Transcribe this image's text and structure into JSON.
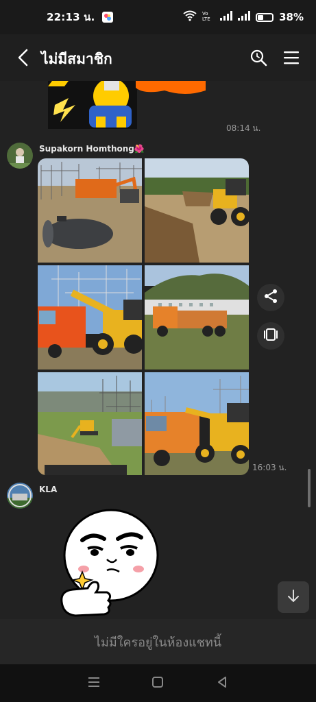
{
  "status_bar": {
    "time": "22:13 น.",
    "battery": "38%",
    "volte": "Vo LTE"
  },
  "header": {
    "title": "ไม่มีสมาชิก"
  },
  "messages": {
    "sticker_time": "08:14 น.",
    "sender_1": "Supakorn Homthong🌺",
    "photos_time": "16:03 น.",
    "sender_2": "KLA"
  },
  "footer": {
    "notice": "ไม่มีใครอยู่ในห้องแชทนี้"
  },
  "icons": {
    "back": "chevron-left-icon",
    "search": "search-icon",
    "menu": "hamburger-menu-icon",
    "share": "share-icon",
    "collection": "collection-icon",
    "scroll_down": "arrow-down-icon"
  },
  "colors": {
    "background": "#1f1f1f",
    "status_bar": "#1a1a1a",
    "input_bar": "#262626",
    "accent": "#ff8c00"
  }
}
